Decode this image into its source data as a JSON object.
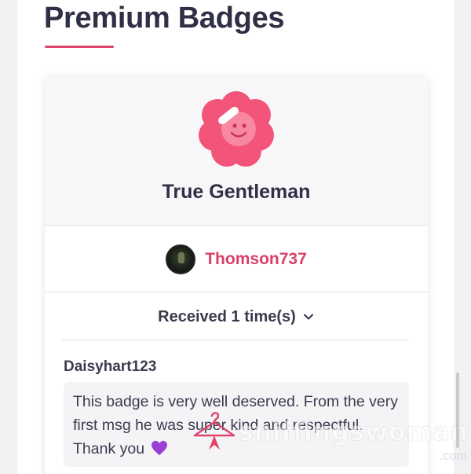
{
  "page": {
    "title": "Premium Badges"
  },
  "badge": {
    "icon": "smiley-flower-badge-icon",
    "name": "True Gentleman",
    "accent_color": "#f2547a"
  },
  "giver": {
    "avatar": "avatar",
    "username": "Thomson737"
  },
  "received": {
    "label": "Received 1 time(s)",
    "icon": "chevron-down-icon"
  },
  "review": {
    "author": "Daisyhart123",
    "text": "This badge is very well deserved. From the very first msg he was super kind and respectful. Thank you",
    "emoji": "purple-heart-icon"
  },
  "watermark": {
    "text": "sniffingswoman",
    "suffix": ".com",
    "icon": "hanger-icon"
  }
}
